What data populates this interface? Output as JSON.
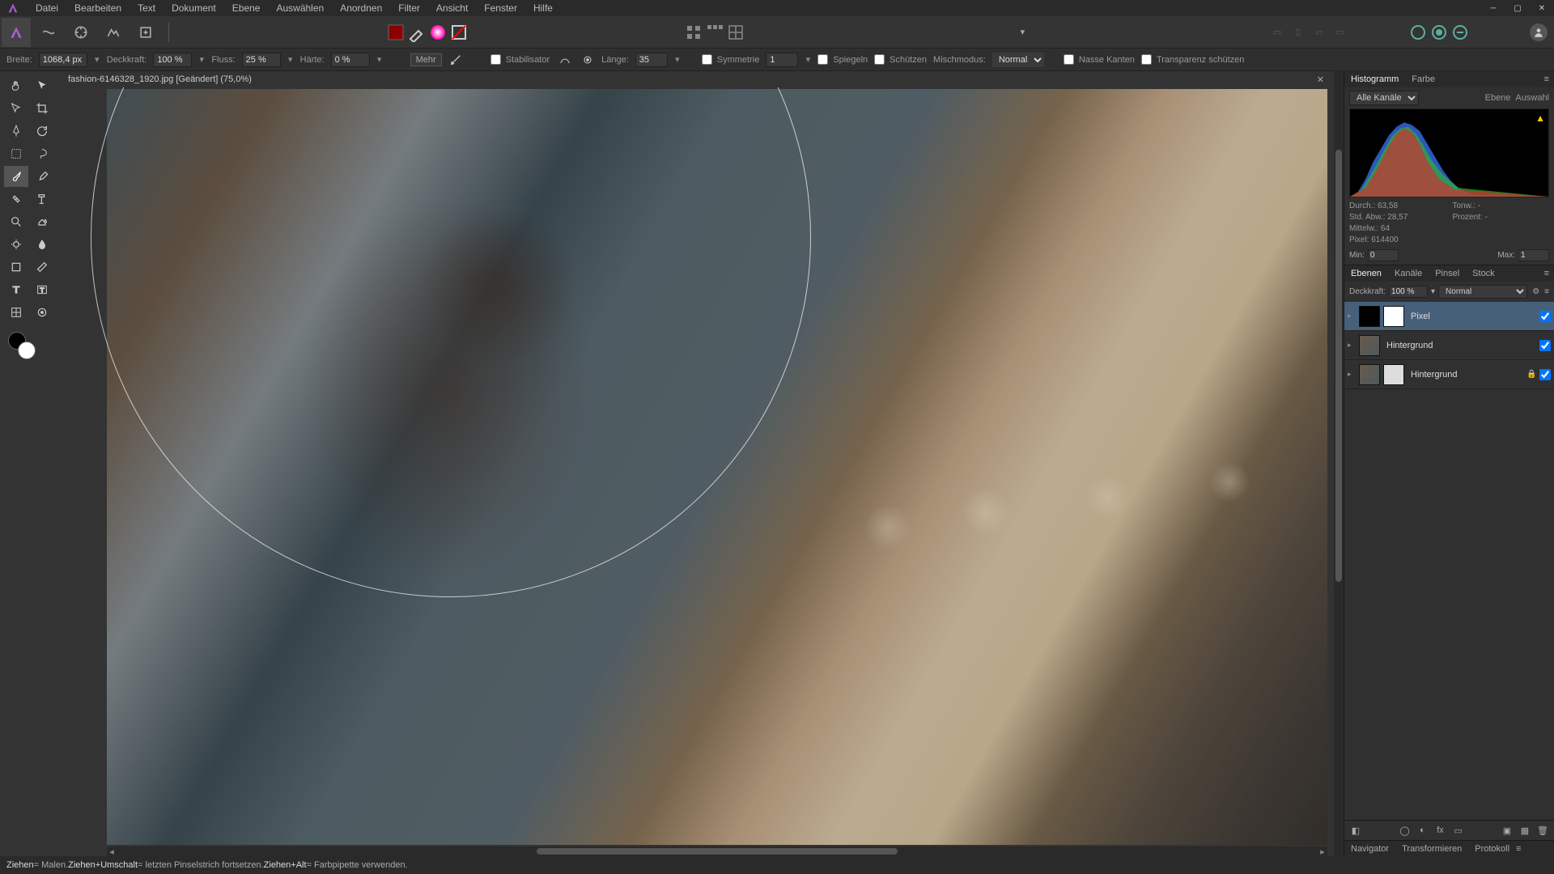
{
  "menu": {
    "datei": "Datei",
    "bearbeiten": "Bearbeiten",
    "text": "Text",
    "dokument": "Dokument",
    "ebene": "Ebene",
    "auswaehlen": "Auswählen",
    "anordnen": "Anordnen",
    "filter": "Filter",
    "ansicht": "Ansicht",
    "fenster": "Fenster",
    "hilfe": "Hilfe"
  },
  "context": {
    "breite_label": "Breite:",
    "breite_value": "1068,4 px",
    "deckkraft_label": "Deckkraft:",
    "deckkraft_value": "100 %",
    "fluss_label": "Fluss:",
    "fluss_value": "25 %",
    "haerte_label": "Härte:",
    "haerte_value": "0 %",
    "mehr_label": "Mehr",
    "stabilisator_label": "Stabilisator",
    "laenge_label": "Länge:",
    "laenge_value": "35",
    "symmetrie_label": "Symmetrie",
    "symmetrie_value": "1",
    "spiegeln_label": "Spiegeln",
    "schuetzen_label": "Schützen",
    "mischmodus_label": "Mischmodus:",
    "mischmodus_value": "Normal",
    "nasse_kanten_label": "Nasse Kanten",
    "transparenz_label": "Transparenz schützen"
  },
  "doc_tab": "fashion-6146328_1920.jpg [Geändert] (75,0%)",
  "panels": {
    "histogram_tab": "Histogramm",
    "farbe_tab": "Farbe",
    "channel_label": "Alle Kanäle",
    "ebene_link": "Ebene",
    "auswahl_link": "Auswahl",
    "durch_label": "Durch.:",
    "durch_value": "63,58",
    "stdabw_label": "Std. Abw.:",
    "stdabw_value": "28,57",
    "mittelw_label": "Mittelw.:",
    "mittelw_value": "64",
    "pixel_label": "Pixel:",
    "pixel_value": "614400",
    "tonw_label": "Tonw.:",
    "tonw_value": "-",
    "prozent_label": "Prozent:",
    "prozent_value": "-",
    "min_label": "Min:",
    "min_value": "0",
    "max_label": "Max:",
    "max_value": "1"
  },
  "layers_panel": {
    "ebenen_tab": "Ebenen",
    "kanaele_tab": "Kanäle",
    "pinsel_tab": "Pinsel",
    "stock_tab": "Stock",
    "deckkraft_label": "Deckkraft:",
    "deckkraft_value": "100 %",
    "blend_value": "Normal",
    "layer1_name": "Pixel",
    "layer2_name": "Hintergrund",
    "layer3_name": "Hintergrund"
  },
  "bottom": {
    "navigator": "Navigator",
    "transformieren": "Transformieren",
    "protokoll": "Protokoll"
  },
  "status": {
    "s1a": "Ziehen",
    "s1b": " = Malen. ",
    "s2a": "Ziehen+Umschalt",
    "s2b": " = letzten Pinselstrich fortsetzen. ",
    "s3a": "Ziehen+Alt",
    "s3b": " = Farbpipette verwenden."
  }
}
